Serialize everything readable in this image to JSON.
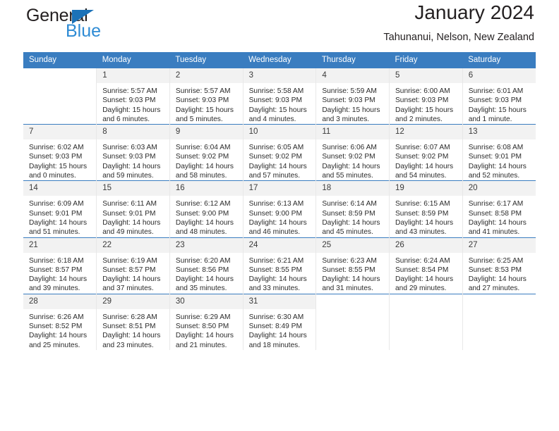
{
  "brand": {
    "name_top": "General",
    "name_bottom": "Blue",
    "color_dark": "#231f20",
    "color_blue": "#2e8bd4",
    "triangle_color": "#1b72b8"
  },
  "header": {
    "title": "January 2024",
    "subtitle": "Tahunanui, Nelson, New Zealand"
  },
  "theme": {
    "header_bg": "#3a7dc0",
    "header_text": "#ffffff",
    "daynum_bg": "#f2f2f2",
    "cell_bg": "#ffffff",
    "row_border": "#3a7dc0",
    "col_border": "#e8e8e8"
  },
  "weekday_headers": [
    "Sunday",
    "Monday",
    "Tuesday",
    "Wednesday",
    "Thursday",
    "Friday",
    "Saturday"
  ],
  "weeks": [
    [
      {
        "day": "",
        "sunrise": "",
        "sunset": "",
        "daylight_line1": "",
        "daylight_line2": "",
        "blank": true
      },
      {
        "day": "1",
        "sunrise": "Sunrise: 5:57 AM",
        "sunset": "Sunset: 9:03 PM",
        "daylight_line1": "Daylight: 15 hours",
        "daylight_line2": "and 6 minutes."
      },
      {
        "day": "2",
        "sunrise": "Sunrise: 5:57 AM",
        "sunset": "Sunset: 9:03 PM",
        "daylight_line1": "Daylight: 15 hours",
        "daylight_line2": "and 5 minutes."
      },
      {
        "day": "3",
        "sunrise": "Sunrise: 5:58 AM",
        "sunset": "Sunset: 9:03 PM",
        "daylight_line1": "Daylight: 15 hours",
        "daylight_line2": "and 4 minutes."
      },
      {
        "day": "4",
        "sunrise": "Sunrise: 5:59 AM",
        "sunset": "Sunset: 9:03 PM",
        "daylight_line1": "Daylight: 15 hours",
        "daylight_line2": "and 3 minutes."
      },
      {
        "day": "5",
        "sunrise": "Sunrise: 6:00 AM",
        "sunset": "Sunset: 9:03 PM",
        "daylight_line1": "Daylight: 15 hours",
        "daylight_line2": "and 2 minutes."
      },
      {
        "day": "6",
        "sunrise": "Sunrise: 6:01 AM",
        "sunset": "Sunset: 9:03 PM",
        "daylight_line1": "Daylight: 15 hours",
        "daylight_line2": "and 1 minute."
      }
    ],
    [
      {
        "day": "7",
        "sunrise": "Sunrise: 6:02 AM",
        "sunset": "Sunset: 9:03 PM",
        "daylight_line1": "Daylight: 15 hours",
        "daylight_line2": "and 0 minutes."
      },
      {
        "day": "8",
        "sunrise": "Sunrise: 6:03 AM",
        "sunset": "Sunset: 9:03 PM",
        "daylight_line1": "Daylight: 14 hours",
        "daylight_line2": "and 59 minutes."
      },
      {
        "day": "9",
        "sunrise": "Sunrise: 6:04 AM",
        "sunset": "Sunset: 9:02 PM",
        "daylight_line1": "Daylight: 14 hours",
        "daylight_line2": "and 58 minutes."
      },
      {
        "day": "10",
        "sunrise": "Sunrise: 6:05 AM",
        "sunset": "Sunset: 9:02 PM",
        "daylight_line1": "Daylight: 14 hours",
        "daylight_line2": "and 57 minutes."
      },
      {
        "day": "11",
        "sunrise": "Sunrise: 6:06 AM",
        "sunset": "Sunset: 9:02 PM",
        "daylight_line1": "Daylight: 14 hours",
        "daylight_line2": "and 55 minutes."
      },
      {
        "day": "12",
        "sunrise": "Sunrise: 6:07 AM",
        "sunset": "Sunset: 9:02 PM",
        "daylight_line1": "Daylight: 14 hours",
        "daylight_line2": "and 54 minutes."
      },
      {
        "day": "13",
        "sunrise": "Sunrise: 6:08 AM",
        "sunset": "Sunset: 9:01 PM",
        "daylight_line1": "Daylight: 14 hours",
        "daylight_line2": "and 52 minutes."
      }
    ],
    [
      {
        "day": "14",
        "sunrise": "Sunrise: 6:09 AM",
        "sunset": "Sunset: 9:01 PM",
        "daylight_line1": "Daylight: 14 hours",
        "daylight_line2": "and 51 minutes."
      },
      {
        "day": "15",
        "sunrise": "Sunrise: 6:11 AM",
        "sunset": "Sunset: 9:01 PM",
        "daylight_line1": "Daylight: 14 hours",
        "daylight_line2": "and 49 minutes."
      },
      {
        "day": "16",
        "sunrise": "Sunrise: 6:12 AM",
        "sunset": "Sunset: 9:00 PM",
        "daylight_line1": "Daylight: 14 hours",
        "daylight_line2": "and 48 minutes."
      },
      {
        "day": "17",
        "sunrise": "Sunrise: 6:13 AM",
        "sunset": "Sunset: 9:00 PM",
        "daylight_line1": "Daylight: 14 hours",
        "daylight_line2": "and 46 minutes."
      },
      {
        "day": "18",
        "sunrise": "Sunrise: 6:14 AM",
        "sunset": "Sunset: 8:59 PM",
        "daylight_line1": "Daylight: 14 hours",
        "daylight_line2": "and 45 minutes."
      },
      {
        "day": "19",
        "sunrise": "Sunrise: 6:15 AM",
        "sunset": "Sunset: 8:59 PM",
        "daylight_line1": "Daylight: 14 hours",
        "daylight_line2": "and 43 minutes."
      },
      {
        "day": "20",
        "sunrise": "Sunrise: 6:17 AM",
        "sunset": "Sunset: 8:58 PM",
        "daylight_line1": "Daylight: 14 hours",
        "daylight_line2": "and 41 minutes."
      }
    ],
    [
      {
        "day": "21",
        "sunrise": "Sunrise: 6:18 AM",
        "sunset": "Sunset: 8:57 PM",
        "daylight_line1": "Daylight: 14 hours",
        "daylight_line2": "and 39 minutes."
      },
      {
        "day": "22",
        "sunrise": "Sunrise: 6:19 AM",
        "sunset": "Sunset: 8:57 PM",
        "daylight_line1": "Daylight: 14 hours",
        "daylight_line2": "and 37 minutes."
      },
      {
        "day": "23",
        "sunrise": "Sunrise: 6:20 AM",
        "sunset": "Sunset: 8:56 PM",
        "daylight_line1": "Daylight: 14 hours",
        "daylight_line2": "and 35 minutes."
      },
      {
        "day": "24",
        "sunrise": "Sunrise: 6:21 AM",
        "sunset": "Sunset: 8:55 PM",
        "daylight_line1": "Daylight: 14 hours",
        "daylight_line2": "and 33 minutes."
      },
      {
        "day": "25",
        "sunrise": "Sunrise: 6:23 AM",
        "sunset": "Sunset: 8:55 PM",
        "daylight_line1": "Daylight: 14 hours",
        "daylight_line2": "and 31 minutes."
      },
      {
        "day": "26",
        "sunrise": "Sunrise: 6:24 AM",
        "sunset": "Sunset: 8:54 PM",
        "daylight_line1": "Daylight: 14 hours",
        "daylight_line2": "and 29 minutes."
      },
      {
        "day": "27",
        "sunrise": "Sunrise: 6:25 AM",
        "sunset": "Sunset: 8:53 PM",
        "daylight_line1": "Daylight: 14 hours",
        "daylight_line2": "and 27 minutes."
      }
    ],
    [
      {
        "day": "28",
        "sunrise": "Sunrise: 6:26 AM",
        "sunset": "Sunset: 8:52 PM",
        "daylight_line1": "Daylight: 14 hours",
        "daylight_line2": "and 25 minutes."
      },
      {
        "day": "29",
        "sunrise": "Sunrise: 6:28 AM",
        "sunset": "Sunset: 8:51 PM",
        "daylight_line1": "Daylight: 14 hours",
        "daylight_line2": "and 23 minutes."
      },
      {
        "day": "30",
        "sunrise": "Sunrise: 6:29 AM",
        "sunset": "Sunset: 8:50 PM",
        "daylight_line1": "Daylight: 14 hours",
        "daylight_line2": "and 21 minutes."
      },
      {
        "day": "31",
        "sunrise": "Sunrise: 6:30 AM",
        "sunset": "Sunset: 8:49 PM",
        "daylight_line1": "Daylight: 14 hours",
        "daylight_line2": "and 18 minutes."
      },
      {
        "day": "",
        "sunrise": "",
        "sunset": "",
        "daylight_line1": "",
        "daylight_line2": "",
        "blank": true
      },
      {
        "day": "",
        "sunrise": "",
        "sunset": "",
        "daylight_line1": "",
        "daylight_line2": "",
        "blank": true
      },
      {
        "day": "",
        "sunrise": "",
        "sunset": "",
        "daylight_line1": "",
        "daylight_line2": "",
        "blank": true
      }
    ]
  ]
}
